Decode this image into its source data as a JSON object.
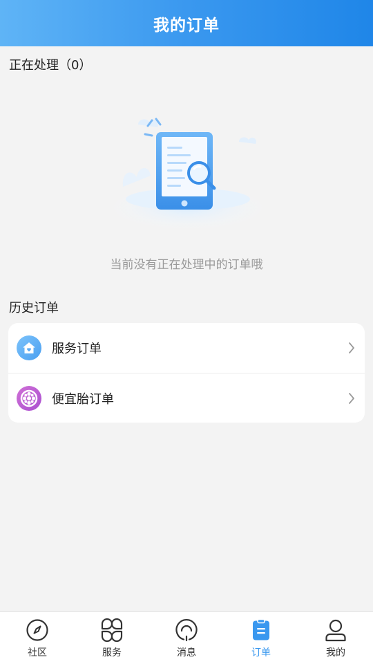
{
  "header": {
    "title": "我的订单"
  },
  "processing": {
    "title": "正在处理（0）",
    "empty_text": "当前没有正在处理中的订单哦"
  },
  "history": {
    "title": "历史订单",
    "items": [
      {
        "label": "服务订单",
        "icon": "house-icon"
      },
      {
        "label": "便宜胎订单",
        "icon": "tire-icon"
      }
    ]
  },
  "tabbar": {
    "active_color": "#3a98ef",
    "items": [
      {
        "label": "社区",
        "icon": "compass-icon"
      },
      {
        "label": "服务",
        "icon": "grid-icon"
      },
      {
        "label": "消息",
        "icon": "message-icon"
      },
      {
        "label": "订单",
        "icon": "clipboard-icon",
        "active": true
      },
      {
        "label": "我的",
        "icon": "user-icon"
      }
    ]
  }
}
